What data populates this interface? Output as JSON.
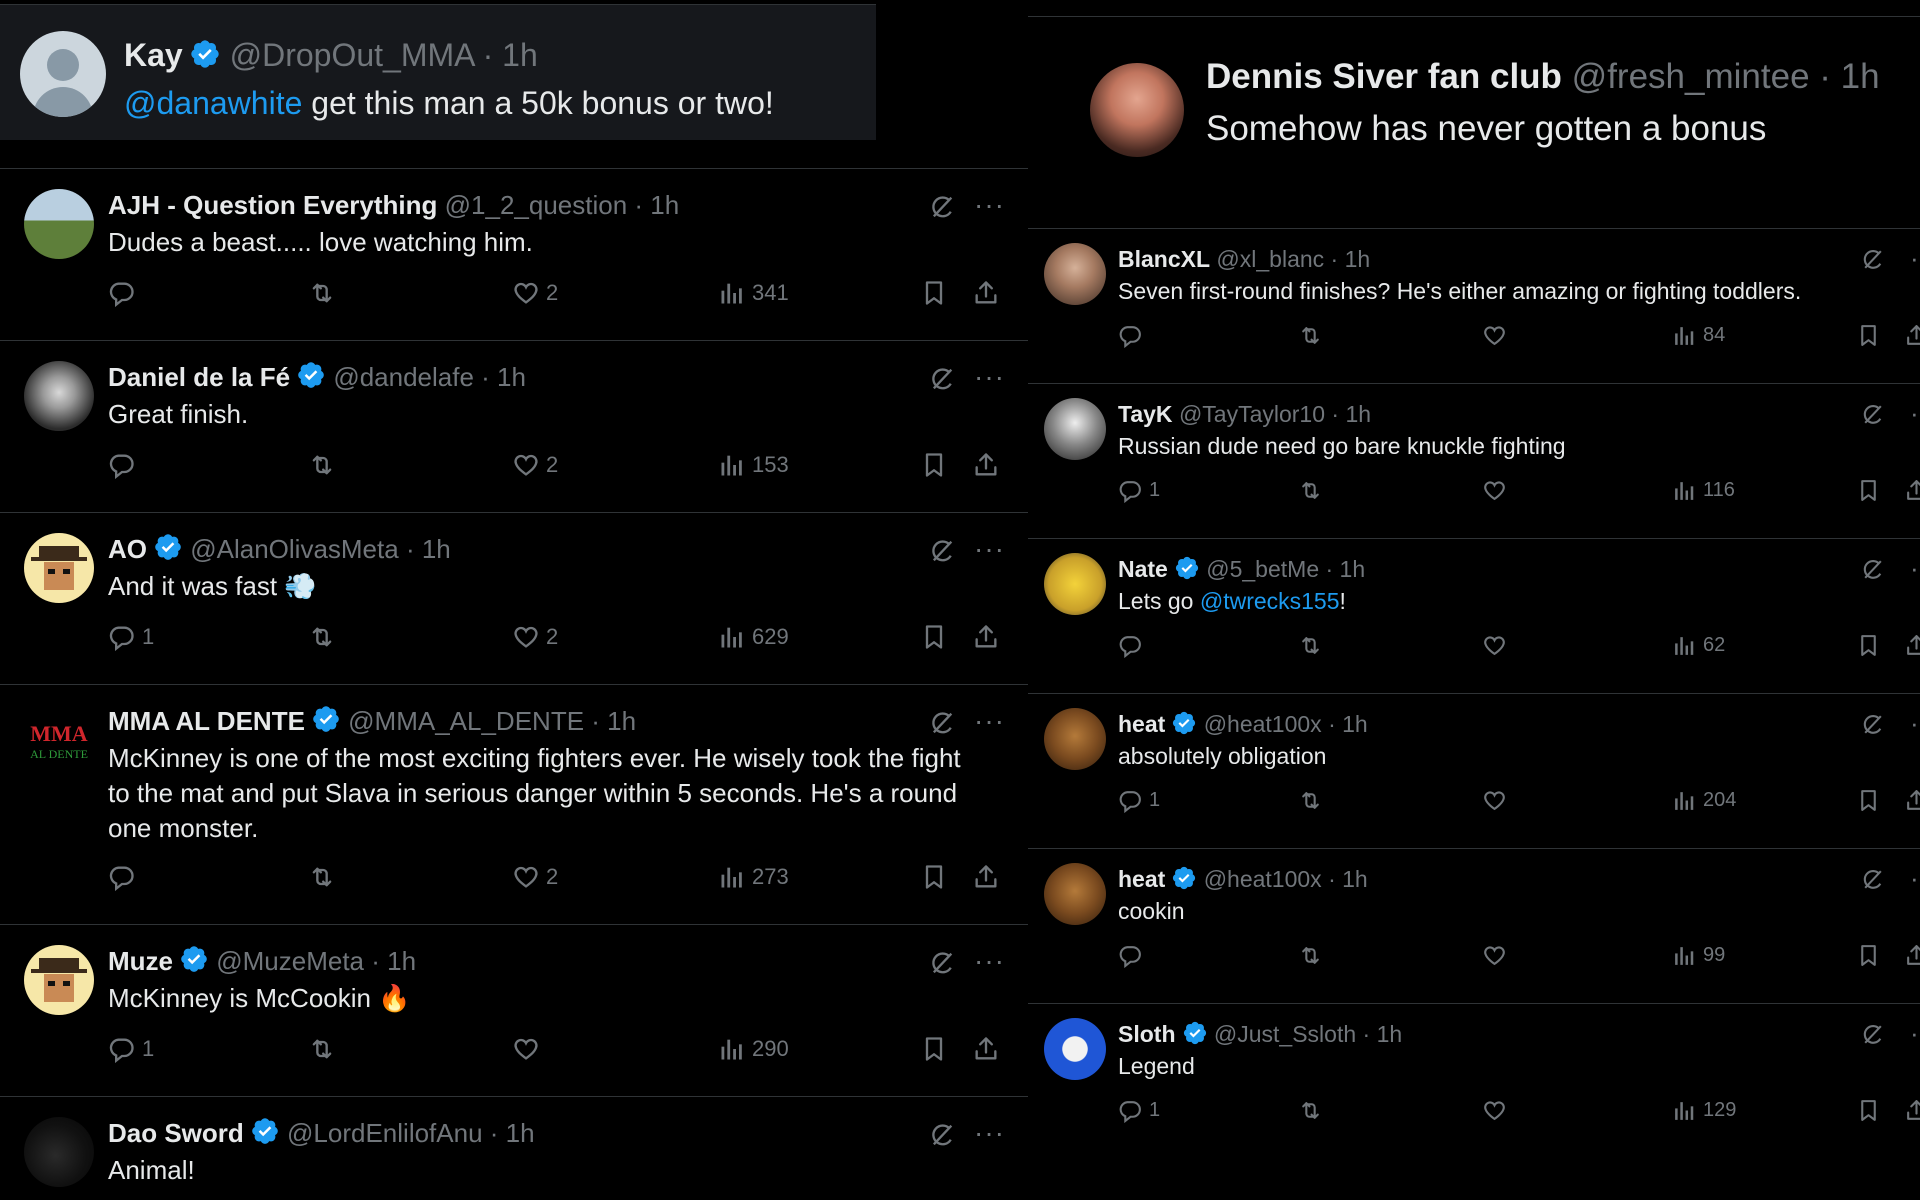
{
  "left": {
    "header": {
      "name": "Kay",
      "handle": "@DropOut_MMA",
      "time": "· 1h",
      "mention": "@danawhite",
      "text": " get this man a 50k bonus or two!"
    },
    "replies": [
      {
        "name": "AJH - Question Everything",
        "handle": "@1_2_question",
        "time": "· 1h",
        "text": "Dudes a beast..... love watching him.",
        "replies": "",
        "likes": "2",
        "views": "341",
        "avatar": "landscape"
      },
      {
        "name": "Daniel de la Fé",
        "handle": "@dandelafe",
        "time": "· 1h",
        "text": "Great finish.",
        "replies": "",
        "likes": "2",
        "views": "153",
        "avatar": "portrait-bw"
      },
      {
        "name": "AO",
        "handle": "@AlanOlivasMeta",
        "time": "· 1h",
        "text": "And it was fast 💨",
        "replies": "1",
        "likes": "2",
        "views": "629",
        "avatar": "pixel-cowboy"
      },
      {
        "name": "MMA AL DENTE",
        "handle": "@MMA_AL_DENTE",
        "time": "· 1h",
        "text": "McKinney is one of the most exciting fighters ever. He wisely took the fight to the mat and put Slava in serious danger within 5 seconds. He's a round one monster.",
        "replies": "",
        "likes": "2",
        "views": "273",
        "avatar": "logo",
        "logo_line1": "MMA",
        "logo_line2": "AL DENTE"
      },
      {
        "name": "Muze",
        "handle": "@MuzeMeta",
        "time": "· 1h",
        "text": "McKinney is McCookin 🔥",
        "replies": "1",
        "likes": "",
        "views": "290",
        "avatar": "pixel-cowboy"
      },
      {
        "name": "Dao Sword",
        "handle": "@LordEnlilofAnu",
        "time": "· 1h",
        "text": "Animal!",
        "replies": "",
        "likes": "",
        "views": "",
        "avatar": "dark-dog"
      }
    ]
  },
  "right": {
    "header": {
      "name": "Dennis Siver fan club",
      "handle": "@fresh_mintee",
      "time": "· 1h",
      "text": "Somehow has never gotten a bonus"
    },
    "replies": [
      {
        "name": "BlancXL",
        "handle": "@xl_blanc",
        "time": "· 1h",
        "verified": false,
        "text": "Seven first-round finishes?  He's either amazing or fighting toddlers.",
        "mention": "",
        "after": "",
        "replies": "",
        "views": "84",
        "avatar": "photo-man"
      },
      {
        "name": "TayK",
        "handle": "@TayTaylor10",
        "time": "· 1h",
        "verified": false,
        "text": "Russian dude need go bare knuckle fighting",
        "mention": "",
        "after": "",
        "replies": "1",
        "views": "116",
        "avatar": "photo-bw"
      },
      {
        "name": "Nate",
        "handle": "@5_betMe",
        "time": "· 1h",
        "verified": true,
        "text": "Lets go ",
        "mention": "@twrecks155",
        "after": "!",
        "replies": "",
        "views": "62",
        "avatar": "cartoon-yellow"
      },
      {
        "name": "heat",
        "handle": "@heat100x",
        "time": "· 1h",
        "verified": true,
        "text": "absolutely obligation",
        "mention": "",
        "after": "",
        "replies": "1",
        "views": "204",
        "avatar": "monkey"
      },
      {
        "name": "heat",
        "handle": "@heat100x",
        "time": "· 1h",
        "verified": true,
        "text": "cookin",
        "mention": "",
        "after": "",
        "replies": "",
        "views": "99",
        "avatar": "monkey"
      },
      {
        "name": "Sloth",
        "handle": "@Just_Ssloth",
        "time": "· 1h",
        "verified": true,
        "text": "Legend",
        "mention": "",
        "after": "",
        "replies": "1",
        "views": "129",
        "avatar": "sloth-blue"
      }
    ]
  },
  "colors": {
    "background": "#000000",
    "header_card": "#16181c",
    "divider": "#2f3336",
    "text": "#e7e9ea",
    "muted": "#71767b",
    "link": "#1d9bf0",
    "verified": "#1d9bf0"
  },
  "icons": [
    "verified-badge-icon",
    "grok-icon",
    "more-icon",
    "reply-icon",
    "retweet-icon",
    "like-icon",
    "views-icon",
    "bookmark-icon",
    "share-icon"
  ]
}
